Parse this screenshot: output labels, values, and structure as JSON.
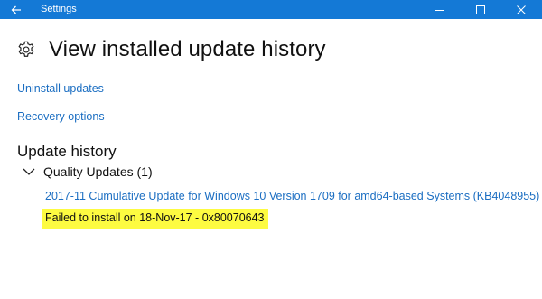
{
  "window": {
    "title": "Settings",
    "controls": {
      "minimize": "minimize-icon",
      "maximize": "maximize-icon",
      "close": "close-icon"
    },
    "accent_color": "#1479d6"
  },
  "page": {
    "title": "View installed update history",
    "icon": "gear-icon"
  },
  "links": {
    "uninstall": "Uninstall updates",
    "recovery": "Recovery options"
  },
  "update_history": {
    "heading": "Update history",
    "groups": [
      {
        "label": "Quality Updates (1)",
        "expanded": true,
        "items": [
          {
            "name": "2017-11 Cumulative Update for Windows 10 Version 1709 for amd64-based Systems (KB4048955)",
            "status": "Failed to install on 18-Nov-17 - 0x80070643",
            "status_highlight": "#fdfb41"
          }
        ]
      }
    ]
  },
  "colors": {
    "link": "#1b6ec2"
  }
}
